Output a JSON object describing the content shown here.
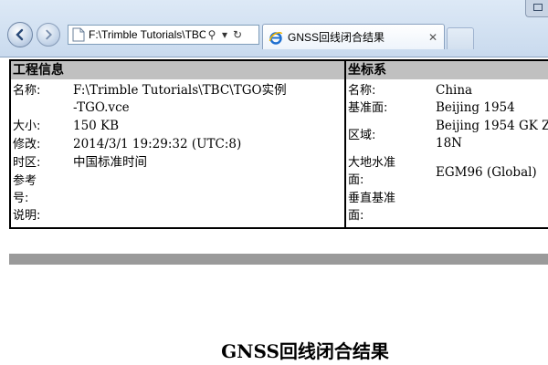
{
  "browser": {
    "address_url": "F:\\Trimble Tutorials\\TBC",
    "search_glyph": "⚲",
    "dropdown_glyph": "▾",
    "refresh_glyph": "↻",
    "tab_title": "GNSS回线闭合结果",
    "tab_close": "✕"
  },
  "project_info": {
    "header": "工程信息",
    "rows": [
      {
        "label": "名称:",
        "value_lines": [
          "F:\\Trimble Tutorials\\TBC\\TGO实例",
          "-TGO.vce"
        ]
      },
      {
        "label": "大小:",
        "value_lines": [
          "150 KB"
        ]
      },
      {
        "label": "修改:",
        "value_lines": [
          "2014/3/1 19:29:32 (UTC:8)"
        ]
      },
      {
        "label": "时区:",
        "value_lines": [
          "中国标准时间"
        ]
      },
      {
        "label_lines": [
          "参考",
          "号:"
        ],
        "value_lines": []
      },
      {
        "label": "说明:",
        "value_lines": []
      }
    ]
  },
  "coordinate_system": {
    "header": "坐标系",
    "rows": [
      {
        "label": "名称:",
        "value": "China"
      },
      {
        "label": "基准面:",
        "value": "Beijing 1954"
      },
      {
        "label": "区域:",
        "value_lines": [
          "Beijing 1954 GK Z",
          "18N"
        ]
      },
      {
        "label_lines": [
          "大地水准",
          "面:"
        ],
        "value": "EGM96 (Global)"
      },
      {
        "label_lines": [
          "垂直基准",
          "面:"
        ],
        "value": ""
      }
    ]
  },
  "report": {
    "title": "GNSS回线闭合结果"
  },
  "colors": {
    "header_bg": "#c0c0c0",
    "separator_bar": "#9a9a9a",
    "chrome_bg": "#c9daee"
  }
}
